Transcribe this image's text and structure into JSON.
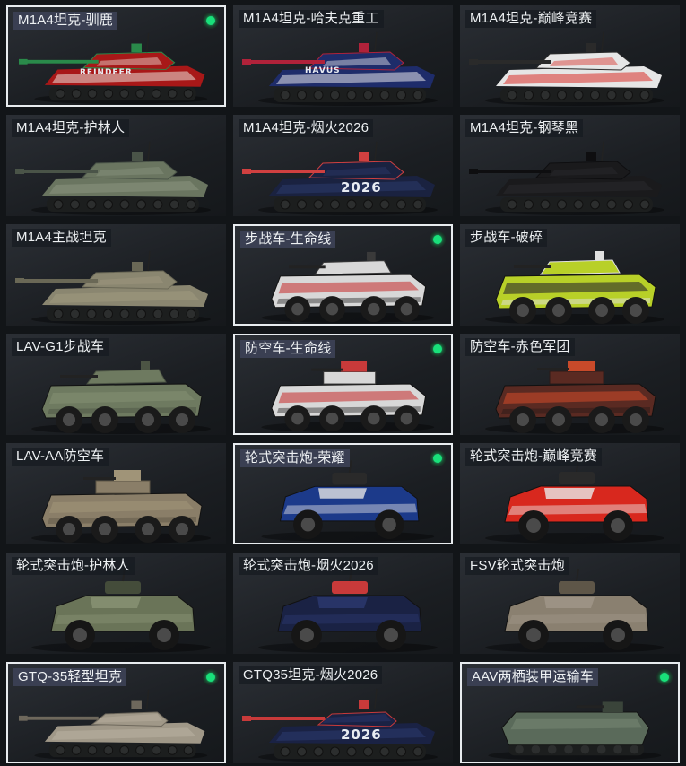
{
  "items": [
    {
      "name": "M1A4坦克-驯鹿",
      "selected": true,
      "owned": true,
      "type": "tank",
      "colors": [
        "#a81818",
        "#e8e0d8",
        "#2a8a4a"
      ],
      "decal": "REINDEER"
    },
    {
      "name": "M1A4坦克-哈夫克重工",
      "selected": false,
      "owned": false,
      "type": "tank",
      "colors": [
        "#1e2c6a",
        "#e6e6ea",
        "#b0223a"
      ],
      "decal": "HAVUS"
    },
    {
      "name": "M1A4坦克-巅峰竞赛",
      "selected": false,
      "owned": false,
      "type": "tank",
      "colors": [
        "#e6e6e6",
        "#d8302a",
        "#2a2a2a"
      ],
      "decal": ""
    },
    {
      "name": "M1A4坦克-护林人",
      "selected": false,
      "owned": false,
      "type": "tank",
      "colors": [
        "#6a7560",
        "#8a9480",
        "#4a5448"
      ],
      "decal": ""
    },
    {
      "name": "M1A4坦克-烟火2026",
      "selected": false,
      "owned": false,
      "type": "tank",
      "colors": [
        "#1a2240",
        "#2c3a6a",
        "#d04040"
      ],
      "decal": "2026"
    },
    {
      "name": "M1A4坦克-钢琴黑",
      "selected": false,
      "owned": false,
      "type": "tank",
      "colors": [
        "#1a1a1c",
        "#2a2a2e",
        "#0e0e10"
      ],
      "decal": ""
    },
    {
      "name": "M1A4主战坦克",
      "selected": false,
      "owned": false,
      "type": "tank",
      "colors": [
        "#8a8670",
        "#a09a80",
        "#6a6856"
      ],
      "decal": ""
    },
    {
      "name": "步战车-生命线",
      "selected": true,
      "owned": true,
      "type": "ifv",
      "colors": [
        "#d8d8d8",
        "#c83a3a",
        "#3a3a3a"
      ],
      "decal": ""
    },
    {
      "name": "步战车-破碎",
      "selected": false,
      "owned": false,
      "type": "ifv",
      "colors": [
        "#b8d028",
        "#2a2a2a",
        "#e0e0e0"
      ],
      "decal": ""
    },
    {
      "name": "LAV-G1步战车",
      "selected": false,
      "owned": false,
      "type": "ifv",
      "colors": [
        "#6e7a60",
        "#828e72",
        "#4c5444"
      ],
      "decal": ""
    },
    {
      "name": "防空车-生命线",
      "selected": true,
      "owned": true,
      "type": "aa",
      "colors": [
        "#d8d8d8",
        "#c83a3a",
        "#3a3a3a"
      ],
      "decal": ""
    },
    {
      "name": "防空车-赤色军团",
      "selected": false,
      "owned": false,
      "type": "aa",
      "colors": [
        "#5a2a22",
        "#c84a2a",
        "#2a1a18"
      ],
      "decal": ""
    },
    {
      "name": "LAV-AA防空车",
      "selected": false,
      "owned": false,
      "type": "aa",
      "colors": [
        "#8a7e68",
        "#a09478",
        "#5e5646"
      ],
      "decal": ""
    },
    {
      "name": "轮式突击炮-荣耀",
      "selected": true,
      "owned": true,
      "type": "apc",
      "colors": [
        "#1c3a8a",
        "#e4e4e4",
        "#2a2a2a"
      ],
      "decal": ""
    },
    {
      "name": "轮式突击炮-巅峰竞赛",
      "selected": false,
      "owned": false,
      "type": "apc",
      "colors": [
        "#d8281e",
        "#eaeaea",
        "#2a2a2a"
      ],
      "decal": ""
    },
    {
      "name": "轮式突击炮-护林人",
      "selected": false,
      "owned": false,
      "type": "apc",
      "colors": [
        "#6a7458",
        "#8a9476",
        "#444c3a"
      ],
      "decal": ""
    },
    {
      "name": "轮式突击炮-烟火2026",
      "selected": false,
      "owned": false,
      "type": "apc",
      "colors": [
        "#1a2244",
        "#2c3a70",
        "#c83a3a"
      ],
      "decal": ""
    },
    {
      "name": "FSV轮式突击炮",
      "selected": false,
      "owned": false,
      "type": "apc",
      "colors": [
        "#8a8070",
        "#a0968a",
        "#5e5648"
      ],
      "decal": ""
    },
    {
      "name": "GTQ-35轻型坦克",
      "selected": true,
      "owned": true,
      "type": "light",
      "colors": [
        "#a09888",
        "#bab2a2",
        "#6e685c"
      ],
      "decal": ""
    },
    {
      "name": "GTQ35坦克-烟火2026",
      "selected": false,
      "owned": false,
      "type": "light",
      "colors": [
        "#1a2244",
        "#2c3a70",
        "#c83a3a"
      ],
      "decal": "2026"
    },
    {
      "name": "AAV两栖装甲运输车",
      "selected": true,
      "owned": true,
      "type": "aav",
      "colors": [
        "#5a6a5a",
        "#7a8a76",
        "#3a443a"
      ],
      "decal": ""
    }
  ]
}
